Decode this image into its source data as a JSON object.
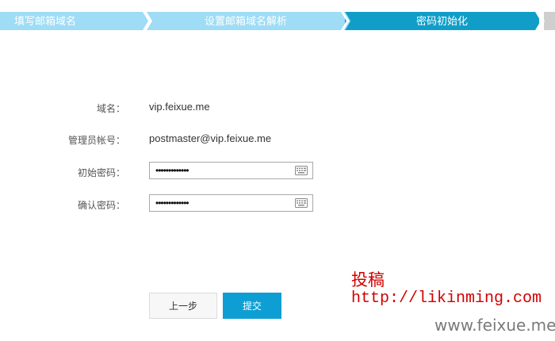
{
  "steps": [
    {
      "label": "填写邮箱域名",
      "state": "done"
    },
    {
      "label": "设置邮箱域名解析",
      "state": "done"
    },
    {
      "label": "密码初始化",
      "state": "active"
    }
  ],
  "form": {
    "domain": {
      "label": "域名：",
      "value": "vip.feixue.me"
    },
    "admin_account": {
      "label": "管理员帐号：",
      "value": "postmaster@vip.feixue.me"
    },
    "init_password": {
      "label": "初始密码：",
      "value": "•••••••••••••"
    },
    "confirm_password": {
      "label": "确认密码：",
      "value": "•••••••••••••"
    }
  },
  "buttons": {
    "prev": "上一步",
    "submit": "提交"
  },
  "watermark": {
    "title": "投稿",
    "url": "http://likinming.com",
    "site": "www.feixue.me"
  },
  "colors": {
    "step_inactive": "#9fdcf5",
    "step_active": "#109ec9",
    "submit_button": "#0d9fd3",
    "watermark_red": "#d10000"
  },
  "icons": {
    "password_field": "keyboard-icon",
    "step_separator": "chevron-right-icon"
  }
}
